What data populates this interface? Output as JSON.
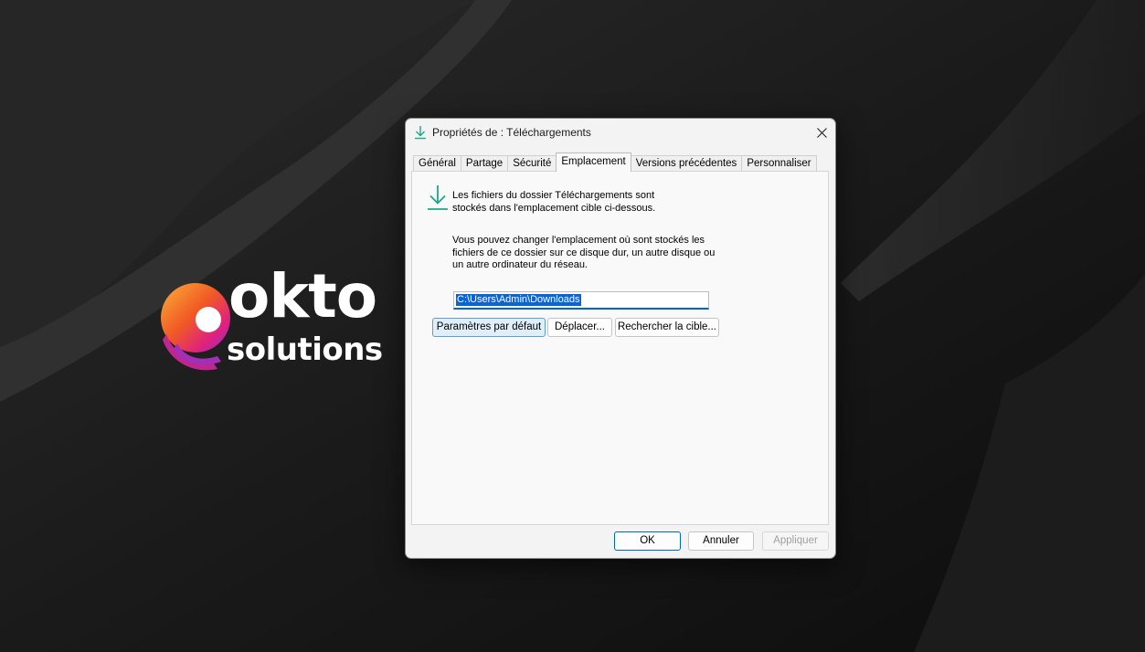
{
  "brand": {
    "logo_word": "okto",
    "logo_subword": "solutions",
    "colors": {
      "orange": "#f7931e",
      "magenta": "#e0217f",
      "purple": "#8b2fc9"
    }
  },
  "dialog": {
    "title": "Propriétés de : Téléchargements",
    "title_icon": "download-arrow-icon",
    "close_icon": "close-icon",
    "tabs": [
      {
        "label": "Général"
      },
      {
        "label": "Partage"
      },
      {
        "label": "Sécurité"
      },
      {
        "label": "Emplacement",
        "active": true
      },
      {
        "label": "Versions précédentes"
      },
      {
        "label": "Personnaliser"
      }
    ],
    "panel": {
      "info_line1": "Les fichiers du dossier Téléchargements sont",
      "info_line2": "stockés dans l'emplacement cible ci-dessous.",
      "desc_line1": "Vous pouvez changer l'emplacement où sont stockés les",
      "desc_line2": "fichiers de ce dossier sur ce disque dur, un autre disque ou",
      "desc_line3": "un autre ordinateur du réseau.",
      "path_value": "C:\\Users\\Admin\\Downloads",
      "buttons": {
        "restore": "Paramètres par défaut",
        "move": "Déplacer...",
        "find": "Rechercher la cible..."
      }
    },
    "footer": {
      "ok": "OK",
      "cancel": "Annuler",
      "apply": "Appliquer"
    },
    "accent_color": "#0067c0",
    "icon_color": "#1aa88a"
  }
}
